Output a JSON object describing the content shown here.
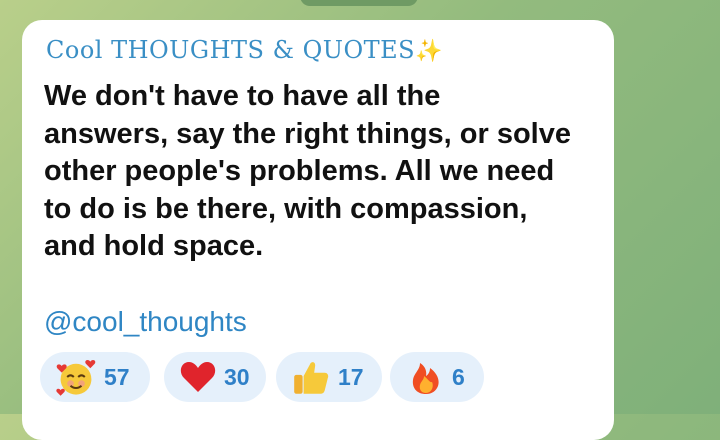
{
  "channel": {
    "title": "Cool THOUGHTS & QUOTES",
    "title_icon": "sparkles-icon"
  },
  "message": {
    "text": "We don't have to have all the\nanswers, say the right things, or solve\nother people's problems. All we need\nto do is be there, with compassion,\nand hold space.",
    "link": "@cool_thoughts"
  },
  "reactions": [
    {
      "emoji": "smiling-face-with-hearts",
      "count": "57"
    },
    {
      "emoji": "red-heart",
      "count": "30"
    },
    {
      "emoji": "thumbs-up",
      "count": "17"
    },
    {
      "emoji": "fire",
      "count": "6"
    }
  ],
  "colors": {
    "accent": "#2f86c4",
    "reaction_bg": "#e5f0fb",
    "background": "#93bb7e"
  }
}
